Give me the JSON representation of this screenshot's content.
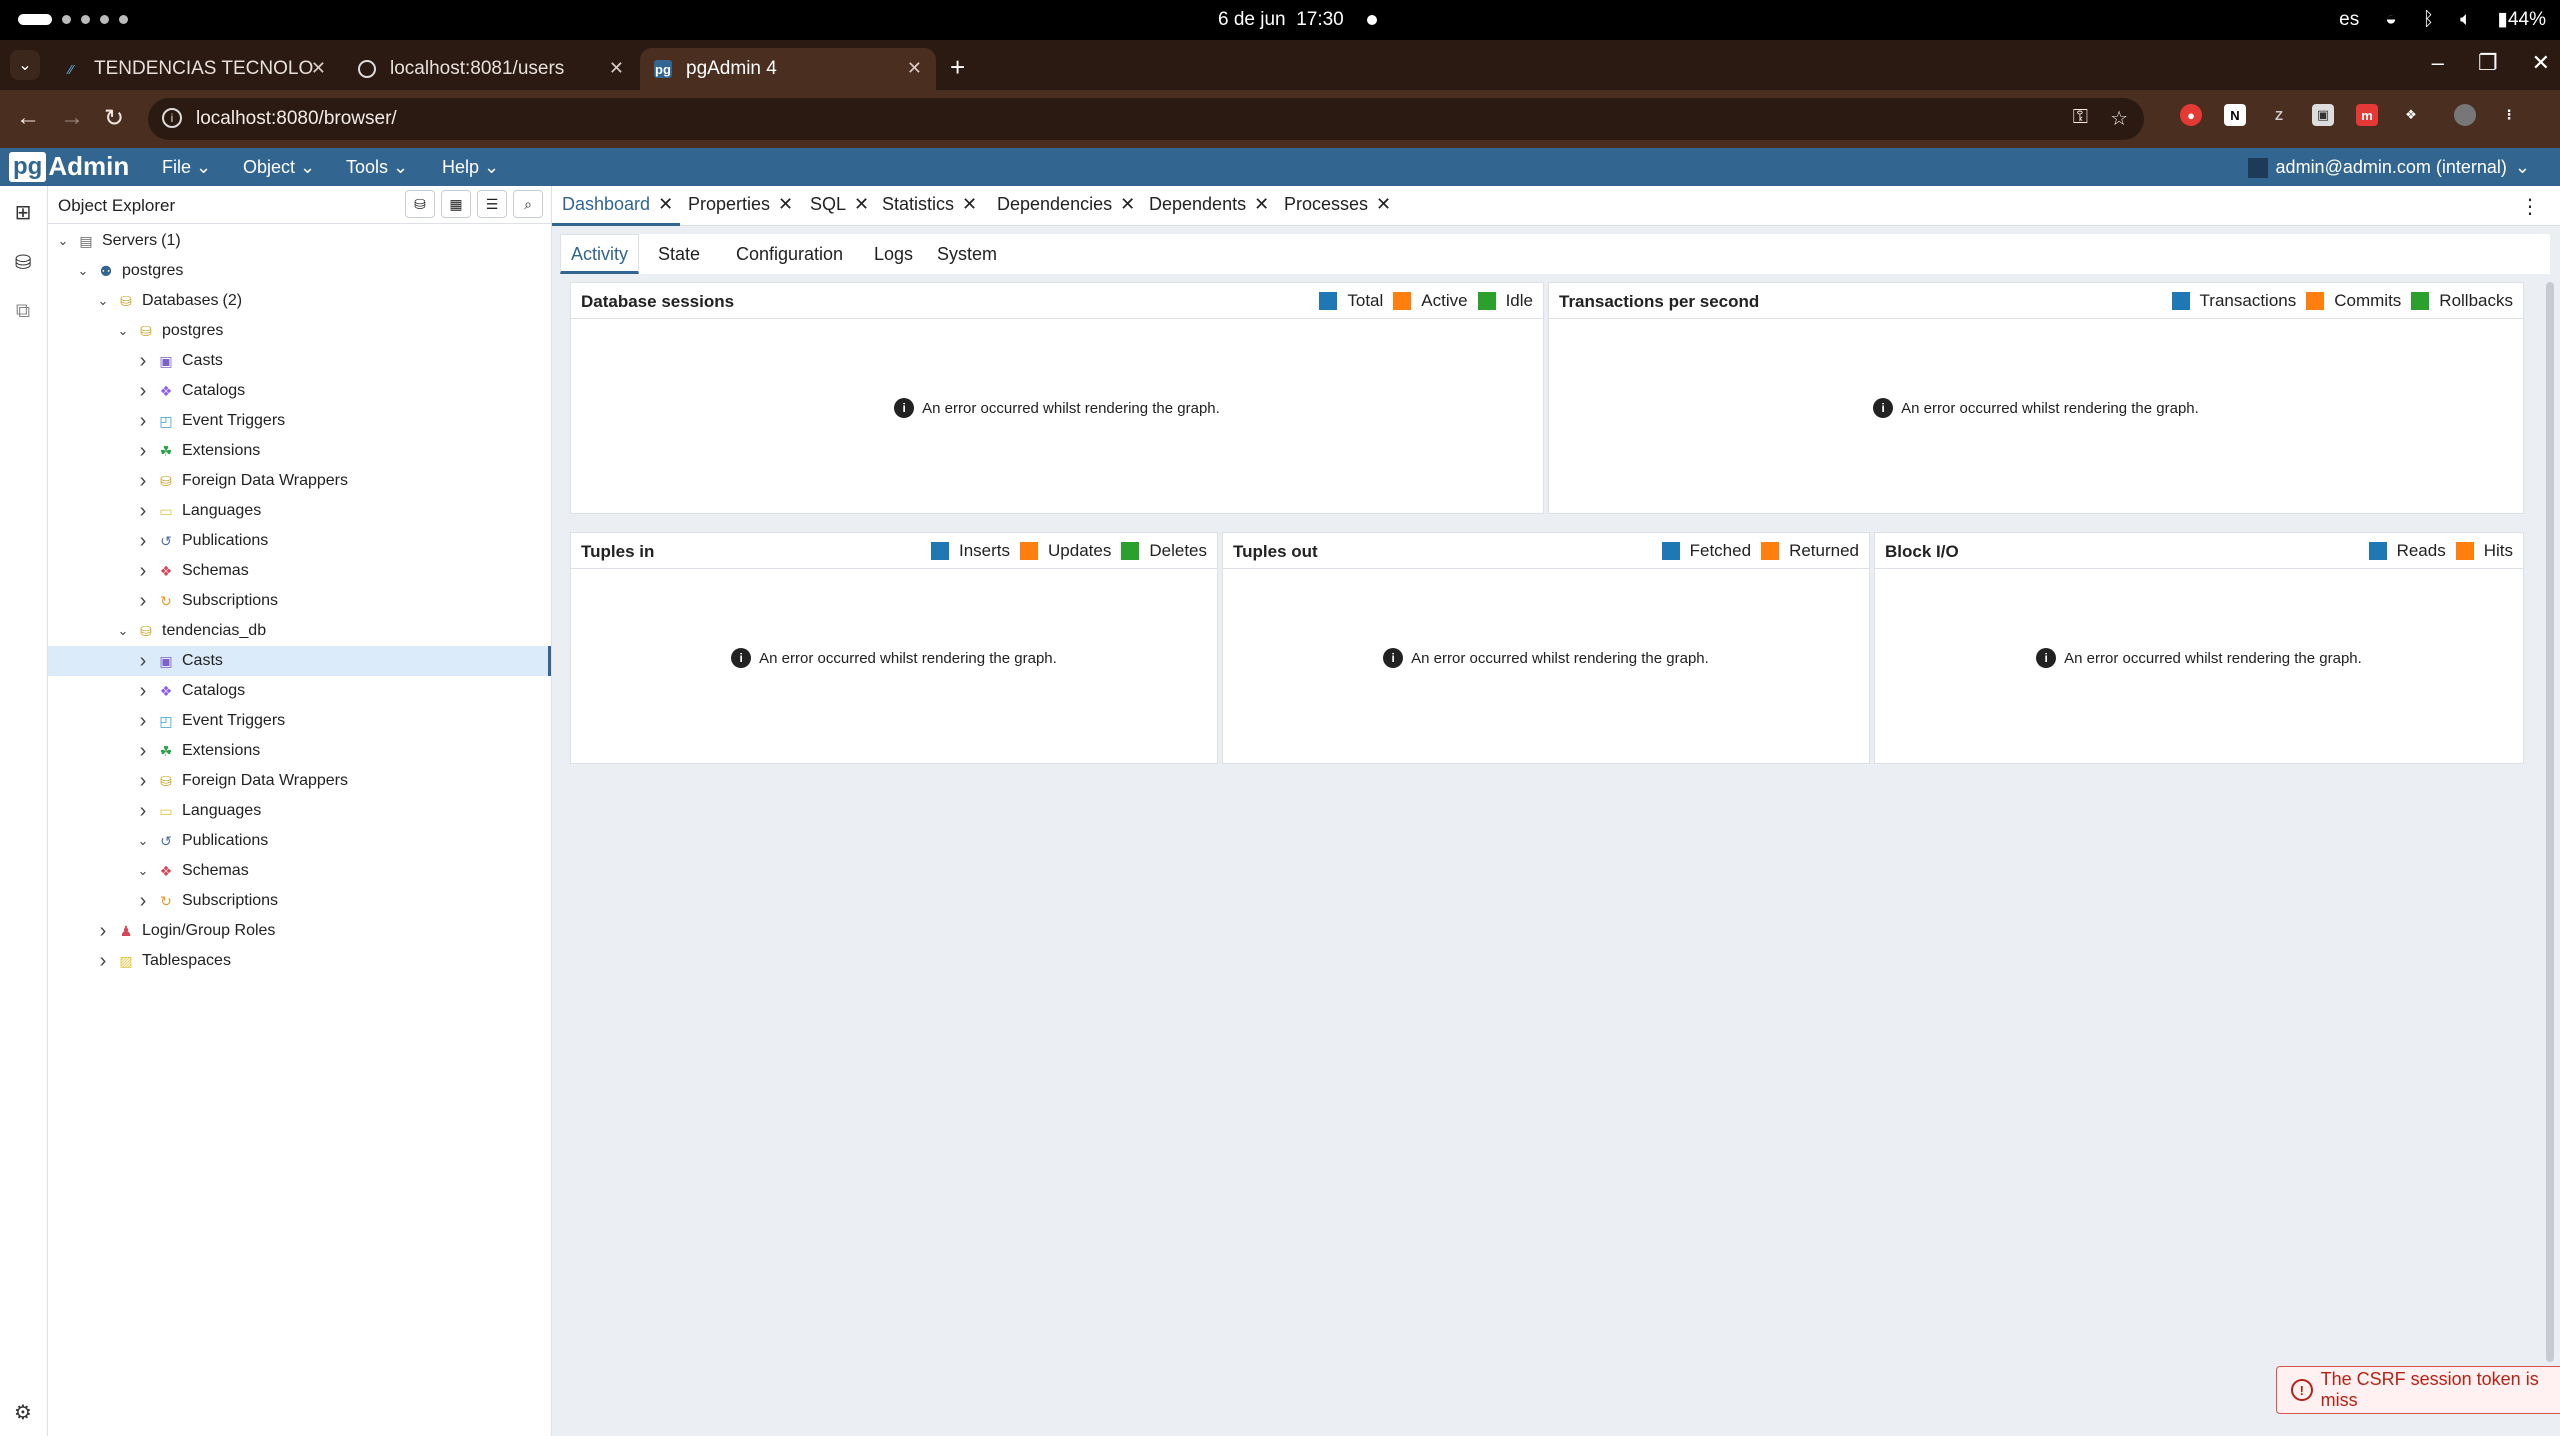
{
  "os": {
    "date": "6 de jun",
    "time": "17:30",
    "lang": "es",
    "battery": "44%"
  },
  "browser": {
    "tabs": [
      {
        "title": "TENDENCIAS TECNOLO",
        "active": false
      },
      {
        "title": "localhost:8081/users",
        "active": false
      },
      {
        "title": "pgAdmin 4",
        "active": true
      }
    ],
    "url": "localhost:8080/browser/"
  },
  "pgadmin": {
    "logo_pg": "pg",
    "logo_admin": "Admin",
    "menu": [
      "File",
      "Object",
      "Tools",
      "Help"
    ],
    "user": "admin@admin.com (internal)"
  },
  "explorer": {
    "title": "Object Explorer",
    "tree": [
      {
        "label": "Servers",
        "count": "(1)",
        "depth": 0,
        "expanded": true,
        "icon": "servers-icon"
      },
      {
        "label": "postgres",
        "depth": 1,
        "expanded": true,
        "icon": "elephant-icon"
      },
      {
        "label": "Databases",
        "count": "(2)",
        "depth": 2,
        "expanded": true,
        "icon": "databases-icon"
      },
      {
        "label": "postgres",
        "depth": 3,
        "expanded": true,
        "icon": "database-icon"
      },
      {
        "label": "Casts",
        "depth": 4,
        "expanded": false,
        "icon": "casts-icon"
      },
      {
        "label": "Catalogs",
        "depth": 4,
        "expanded": false,
        "icon": "catalogs-icon"
      },
      {
        "label": "Event Triggers",
        "depth": 4,
        "expanded": false,
        "icon": "event-triggers-icon"
      },
      {
        "label": "Extensions",
        "depth": 4,
        "expanded": false,
        "icon": "extensions-icon"
      },
      {
        "label": "Foreign Data Wrappers",
        "depth": 4,
        "expanded": false,
        "icon": "fdw-icon"
      },
      {
        "label": "Languages",
        "depth": 4,
        "expanded": false,
        "icon": "languages-icon"
      },
      {
        "label": "Publications",
        "depth": 4,
        "expanded": false,
        "icon": "publications-icon"
      },
      {
        "label": "Schemas",
        "depth": 4,
        "expanded": false,
        "icon": "schemas-icon"
      },
      {
        "label": "Subscriptions",
        "depth": 4,
        "expanded": false,
        "icon": "subscriptions-icon"
      },
      {
        "label": "tendencias_db",
        "depth": 3,
        "expanded": true,
        "icon": "database-icon"
      },
      {
        "label": "Casts",
        "depth": 4,
        "expanded": false,
        "icon": "casts-icon",
        "selected": true
      },
      {
        "label": "Catalogs",
        "depth": 4,
        "expanded": false,
        "icon": "catalogs-icon"
      },
      {
        "label": "Event Triggers",
        "depth": 4,
        "expanded": false,
        "icon": "event-triggers-icon"
      },
      {
        "label": "Extensions",
        "depth": 4,
        "expanded": false,
        "icon": "extensions-icon"
      },
      {
        "label": "Foreign Data Wrappers",
        "depth": 4,
        "expanded": false,
        "icon": "fdw-icon"
      },
      {
        "label": "Languages",
        "depth": 4,
        "expanded": false,
        "icon": "languages-icon"
      },
      {
        "label": "Publications",
        "depth": 4,
        "expanded": true,
        "icon": "publications-icon"
      },
      {
        "label": "Schemas",
        "depth": 4,
        "expanded": true,
        "icon": "schemas-icon"
      },
      {
        "label": "Subscriptions",
        "depth": 4,
        "expanded": false,
        "icon": "subscriptions-icon"
      },
      {
        "label": "Login/Group Roles",
        "depth": 2,
        "expanded": false,
        "icon": "roles-icon"
      },
      {
        "label": "Tablespaces",
        "depth": 2,
        "expanded": false,
        "icon": "tablespaces-icon"
      }
    ]
  },
  "panel_tabs": [
    "Dashboard",
    "Properties",
    "SQL",
    "Statistics",
    "Dependencies",
    "Dependents",
    "Processes"
  ],
  "sub_tabs": [
    "Activity",
    "State",
    "Configuration",
    "Logs",
    "System"
  ],
  "colors": {
    "blue": "#1f77b4",
    "orange": "#ff7f0e",
    "green": "#2ca02c",
    "brand": "#326690"
  },
  "error_text": "An error occurred whilst rendering the graph.",
  "cards": [
    {
      "title": "Database sessions",
      "legend": [
        [
          "Total",
          "#1f77b4"
        ],
        [
          "Active",
          "#ff7f0e"
        ],
        [
          "Idle",
          "#2ca02c"
        ]
      ]
    },
    {
      "title": "Transactions per second",
      "legend": [
        [
          "Transactions",
          "#1f77b4"
        ],
        [
          "Commits",
          "#ff7f0e"
        ],
        [
          "Rollbacks",
          "#2ca02c"
        ]
      ]
    },
    {
      "title": "Tuples in",
      "legend": [
        [
          "Inserts",
          "#1f77b4"
        ],
        [
          "Updates",
          "#ff7f0e"
        ],
        [
          "Deletes",
          "#2ca02c"
        ]
      ]
    },
    {
      "title": "Tuples out",
      "legend": [
        [
          "Fetched",
          "#1f77b4"
        ],
        [
          "Returned",
          "#ff7f0e"
        ]
      ]
    },
    {
      "title": "Block I/O",
      "legend": [
        [
          "Reads",
          "#1f77b4"
        ],
        [
          "Hits",
          "#ff7f0e"
        ]
      ]
    }
  ],
  "toast": "The CSRF session token is miss"
}
